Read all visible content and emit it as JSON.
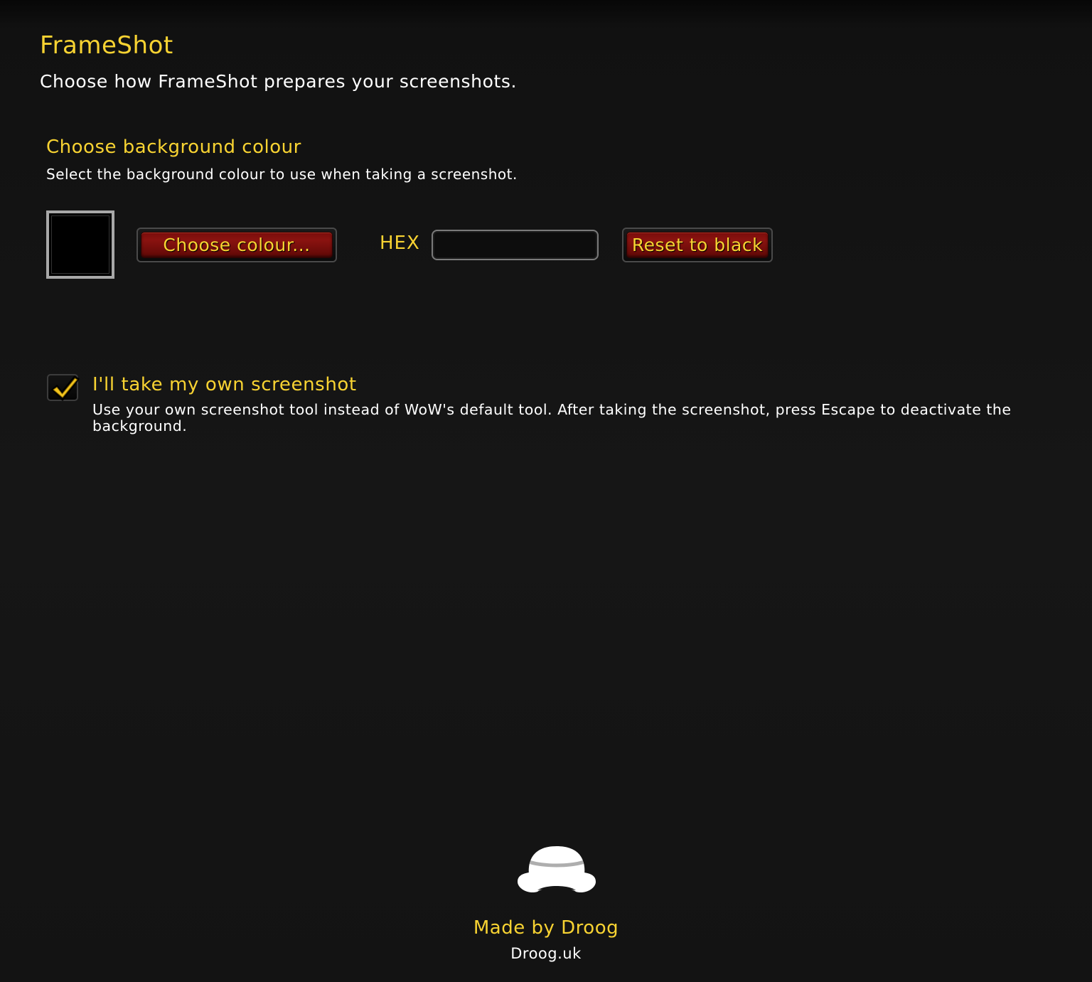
{
  "header": {
    "title": "FrameShot",
    "subtitle": "Choose how FrameShot prepares your screenshots."
  },
  "background_section": {
    "heading": "Choose background colour",
    "description": "Select the background colour to use when taking a screenshot.",
    "swatch_color": "#000000",
    "choose_button_label": "Choose colour...",
    "hex_label": "HEX",
    "hex_value": "",
    "reset_button_label": "Reset to black"
  },
  "own_screenshot": {
    "checked": true,
    "label": "I'll take my own screenshot",
    "description": "Use your own screenshot tool instead of WoW's default tool. After taking the screenshot, press Escape to deactivate the background."
  },
  "footer": {
    "icon": "bowler-hat-icon",
    "credit": "Made by Droog",
    "link": "Droog.uk"
  },
  "colors": {
    "accent_gold": "#f8d332",
    "button_red": "#8a1310",
    "background": "#151515"
  }
}
